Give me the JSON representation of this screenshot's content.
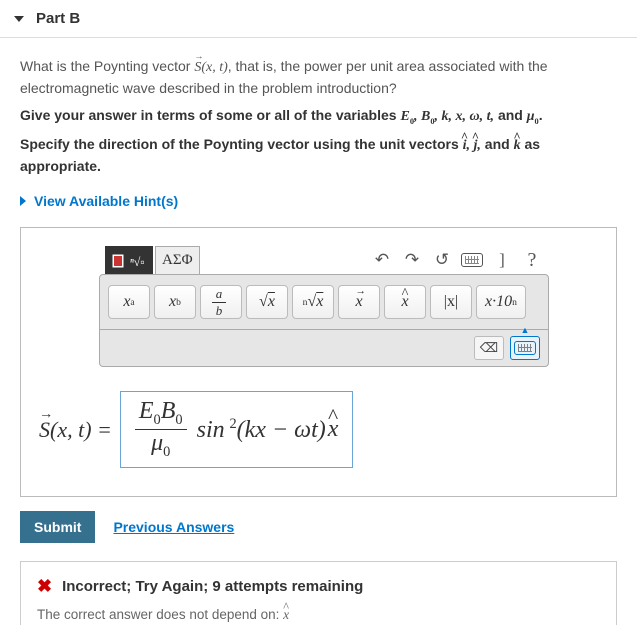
{
  "header": {
    "title": "Part B"
  },
  "question": {
    "line1_pre": "What is the Poynting vector ",
    "line1_sym": "S⃗(x,t)",
    "line1_post": ", that is, the power per unit area associated with the electromagnetic wave described in the problem introduction?",
    "line2_pre": "Give your answer in terms of some or all of the variables ",
    "line2_vars": "E₀, B₀, k, x, ω, t,",
    "line2_and": " and ",
    "line2_mu": "μ₀",
    "line2_end": ".",
    "line3_pre": "Specify the direction of the Poynting vector using the unit vectors ",
    "line3_vecs": "î, ĵ,",
    "line3_and": " and ",
    "line3_k": "k̂",
    "line3_post": " as appropriate."
  },
  "hints": {
    "label": "View Available Hint(s)"
  },
  "editor": {
    "tab_template_title": "Templates",
    "tab_greek": "ΑΣΦ",
    "help": "?",
    "rbracket": "]",
    "buttons": {
      "xa": "xᵃ",
      "xb": "xᵦ",
      "frac": "a⁄b",
      "sqrt": "√x",
      "nroot": "ⁿ√x",
      "vec": "x⃗",
      "hat": "x̂",
      "abs": "|x|",
      "sci": "x·10ⁿ"
    }
  },
  "answer": {
    "lhs": "S⃗(x,t) = ",
    "frac_num": "E₀B₀",
    "frac_den": "μ₀",
    "expr_mid": "sin²(kx − ωt)",
    "expr_hat": "x̂"
  },
  "actions": {
    "submit": "Submit",
    "previous": "Previous Answers"
  },
  "feedback": {
    "title": "Incorrect; Try Again; 9 attempts remaining",
    "sub_pre": "The correct answer does not depend on: ",
    "sub_var": "x̂"
  }
}
